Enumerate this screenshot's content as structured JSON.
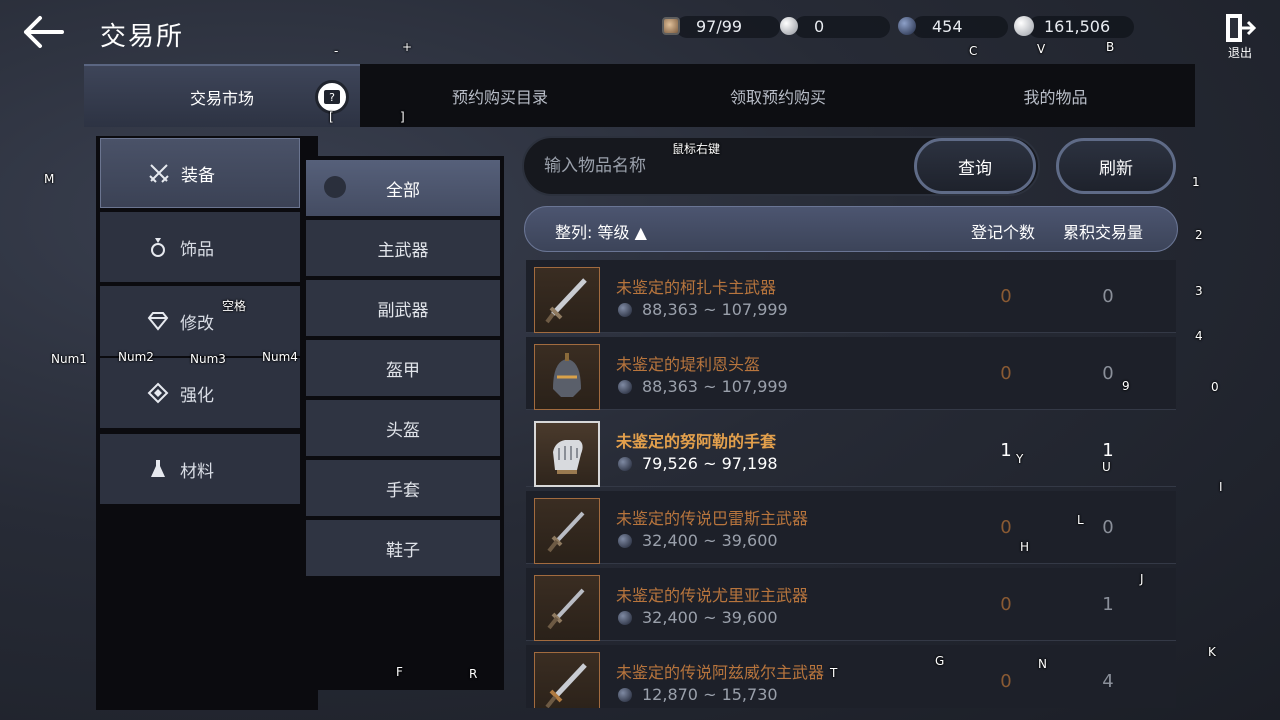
{
  "header": {
    "title": "交易所",
    "exit_label": "退出"
  },
  "currencies": [
    {
      "icon": "contribution-icon",
      "value": "97/99",
      "color": "#c9a27a"
    },
    {
      "icon": "silver-coin-icon",
      "value": "0",
      "color": "#c8ccd4"
    },
    {
      "icon": "blue-gem-icon",
      "value": "454",
      "color": "#3b4a6e"
    },
    {
      "icon": "gold-coin-icon",
      "value": "161,506",
      "color": "#d9d9d9"
    }
  ],
  "tabs": [
    {
      "label": "交易市场"
    },
    {
      "label": "预约购买目录"
    },
    {
      "label": "领取预约购买"
    },
    {
      "label": "我的物品"
    }
  ],
  "categories": [
    {
      "label": "装备",
      "icon": "crossed-swords-icon"
    },
    {
      "label": "饰品",
      "icon": "ring-icon"
    },
    {
      "label": "修改",
      "icon": "gem-icon"
    },
    {
      "label": "强化",
      "icon": "diamond-arrow-icon"
    },
    {
      "label": "材料",
      "icon": "flask-icon"
    }
  ],
  "subcategories": [
    {
      "label": "全部"
    },
    {
      "label": "主武器"
    },
    {
      "label": "副武器"
    },
    {
      "label": "盔甲"
    },
    {
      "label": "头盔"
    },
    {
      "label": "手套"
    },
    {
      "label": "鞋子"
    }
  ],
  "search": {
    "placeholder": "输入物品名称",
    "query_label": "查询",
    "refresh_label": "刷新"
  },
  "sort": {
    "label": "整列: 等级 ▲",
    "col_registered": "登记个数",
    "col_accumulated": "累积交易量"
  },
  "items": [
    {
      "name": "未鉴定的柯扎卡主武器",
      "price": "88,363 ~ 107,999",
      "registered": "0",
      "accumulated": "0",
      "icon": "sword-icon"
    },
    {
      "name": "未鉴定的堤利恩头盔",
      "price": "88,363 ~ 107,999",
      "registered": "0",
      "accumulated": "0",
      "icon": "helmet-icon"
    },
    {
      "name": "未鉴定的努阿勒的手套",
      "price": "79,526 ~ 97,198",
      "registered": "1",
      "accumulated": "1",
      "icon": "gauntlet-icon"
    },
    {
      "name": "未鉴定的传说巴雷斯主武器",
      "price": "32,400 ~ 39,600",
      "registered": "0",
      "accumulated": "0",
      "icon": "dagger-icon"
    },
    {
      "name": "未鉴定的传说尤里亚主武器",
      "price": "32,400 ~ 39,600",
      "registered": "0",
      "accumulated": "1",
      "icon": "dagger-icon"
    },
    {
      "name": "未鉴定的传说阿兹威尔主武器",
      "price": "12,870 ~ 15,730",
      "registered": "0",
      "accumulated": "4",
      "icon": "sword-icon"
    }
  ],
  "hotkeys": {
    "minus": "-",
    "plus": "+",
    "c": "C",
    "v": "V",
    "b": "B",
    "lbracket": "[",
    "rbracket": "]",
    "right_click": "鼠标右键",
    "m": "M",
    "space": "空格",
    "num1": "Num1",
    "num2": "Num2",
    "num3": "Num3",
    "num4": "Num4",
    "k1": "1",
    "k2": "2",
    "k3": "3",
    "k4": "4",
    "k9": "9",
    "k0": "0",
    "y": "Y",
    "u": "U",
    "i": "I",
    "l": "L",
    "h": "H",
    "j": "J",
    "g": "G",
    "n": "N",
    "t": "T",
    "k": "K",
    "f": "F",
    "r": "R"
  }
}
